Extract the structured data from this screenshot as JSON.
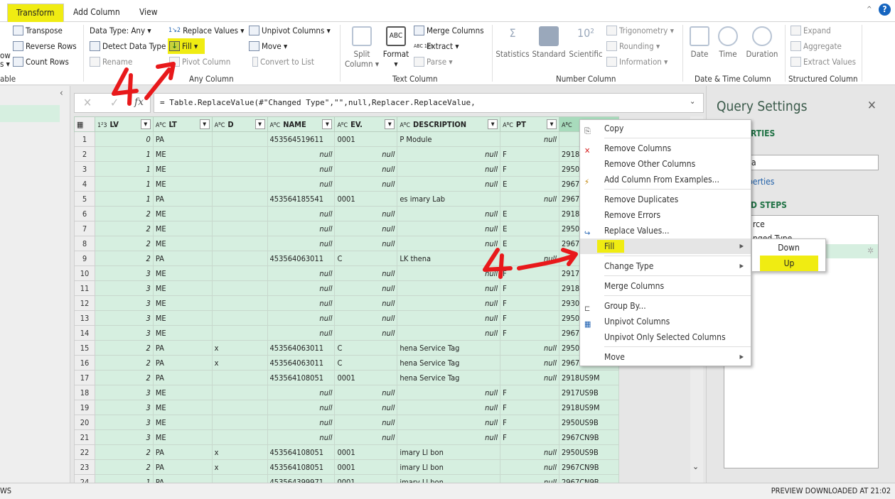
{
  "tabs": [
    "Transform",
    "Add Column",
    "View"
  ],
  "ribbon": {
    "table_group": {
      "label": "able",
      "partial": [
        "ow",
        "s ▾"
      ],
      "items": [
        "Transpose",
        "Reverse Rows",
        "Count Rows"
      ]
    },
    "any_column": {
      "label": "Any Column",
      "data_type": "Data Type: Any ▾",
      "detect": "Detect Data Type",
      "rename": "Rename",
      "replace": "Replace Values ▾",
      "fill": "Fill ▾",
      "pivot": "Pivot Column",
      "unpivot": "Unpivot Columns ▾",
      "move": "Move ▾",
      "convert": "Convert to List"
    },
    "text_column": {
      "label": "Text Column",
      "split": "Split Column ▾",
      "format": "Format ▾",
      "merge": "Merge Columns",
      "extract": "Extract ▾",
      "parse": "Parse ▾"
    },
    "number_column": {
      "label": "Number Column",
      "statistics": "Statistics",
      "standard": "Standard",
      "scientific": "Scientific",
      "trig": "Trigonometry ▾",
      "rounding": "Rounding ▾",
      "information": "Information ▾"
    },
    "datetime": {
      "label": "Date & Time Column",
      "date": "Date",
      "time": "Time",
      "duration": "Duration"
    },
    "structured": {
      "label": "Structured Column",
      "expand": "Expand",
      "aggregate": "Aggregate",
      "extract_values": "Extract Values"
    }
  },
  "formula": "= Table.ReplaceValue(#\"Changed Type\",\"\",null,Replacer.ReplaceValue,",
  "columns": [
    {
      "type": "1²3",
      "name": "LV"
    },
    {
      "type": "AᴮC",
      "name": "LT"
    },
    {
      "type": "AᴮC",
      "name": "D"
    },
    {
      "type": "AᴮC",
      "name": "NAME"
    },
    {
      "type": "AᴮC",
      "name": "EV."
    },
    {
      "type": "AᴮC",
      "name": "DESCRIPTION"
    },
    {
      "type": "AᴮC",
      "name": "PT"
    },
    {
      "type": "AᴮC",
      "name": ""
    }
  ],
  "rows": [
    [
      "1",
      "0",
      "PA",
      "",
      "453564519611",
      "0001",
      "P Module",
      "null",
      ""
    ],
    [
      "2",
      "1",
      "ME",
      "",
      "null",
      "null",
      "null",
      "F",
      "2918"
    ],
    [
      "3",
      "1",
      "ME",
      "",
      "null",
      "null",
      "null",
      "F",
      "2950"
    ],
    [
      "4",
      "1",
      "ME",
      "",
      "null",
      "null",
      "null",
      "E",
      "2967"
    ],
    [
      "5",
      "1",
      "PA",
      "",
      "453564185541",
      "0001",
      "es imary Lab",
      "null",
      "2967"
    ],
    [
      "6",
      "2",
      "ME",
      "",
      "null",
      "null",
      "null",
      "E",
      "2918"
    ],
    [
      "7",
      "2",
      "ME",
      "",
      "null",
      "null",
      "null",
      "E",
      "2950"
    ],
    [
      "8",
      "2",
      "ME",
      "",
      "null",
      "null",
      "null",
      "E",
      "2967"
    ],
    [
      "9",
      "2",
      "PA",
      "",
      "453564063011",
      "C",
      "LK thena",
      "null",
      ""
    ],
    [
      "10",
      "3",
      "ME",
      "",
      "null",
      "null",
      "null",
      "F",
      "2917"
    ],
    [
      "11",
      "3",
      "ME",
      "",
      "null",
      "null",
      "null",
      "F",
      "2918"
    ],
    [
      "12",
      "3",
      "ME",
      "",
      "null",
      "null",
      "null",
      "F",
      "2930"
    ],
    [
      "13",
      "3",
      "ME",
      "",
      "null",
      "null",
      "null",
      "F",
      "2950"
    ],
    [
      "14",
      "3",
      "ME",
      "",
      "null",
      "null",
      "null",
      "F",
      "2967"
    ],
    [
      "15",
      "2",
      "PA",
      "x",
      "453564063011",
      "C",
      "hena Service Tag",
      "null",
      "2950"
    ],
    [
      "16",
      "2",
      "PA",
      "x",
      "453564063011",
      "C",
      "hena Service Tag",
      "null",
      "2967"
    ],
    [
      "17",
      "2",
      "PA",
      "",
      "453564108051",
      "0001",
      "hena Service Tag",
      "null",
      "2918US9M"
    ],
    [
      "18",
      "3",
      "ME",
      "",
      "null",
      "null",
      "null",
      "F",
      "2917US9B"
    ],
    [
      "19",
      "3",
      "ME",
      "",
      "null",
      "null",
      "null",
      "F",
      "2918US9M"
    ],
    [
      "20",
      "3",
      "ME",
      "",
      "null",
      "null",
      "null",
      "F",
      "2950US9B"
    ],
    [
      "21",
      "3",
      "ME",
      "",
      "null",
      "null",
      "null",
      "F",
      "2967CN9B"
    ],
    [
      "22",
      "2",
      "PA",
      "x",
      "453564108051",
      "0001",
      "imary Ll bon",
      "null",
      "2950US9B"
    ],
    [
      "23",
      "2",
      "PA",
      "x",
      "453564108051",
      "0001",
      "imary Ll bon",
      "null",
      "2967CN9B"
    ],
    [
      "24",
      "1",
      "PA",
      "",
      "453564399971",
      "0001",
      "imary Ll bon",
      "null",
      "2967CN9B"
    ]
  ],
  "query_settings": {
    "title": "Query Settings",
    "properties_heading": "RTIES",
    "name_value": "a",
    "all_properties": "perties",
    "steps_heading": "D STEPS",
    "steps": [
      "rce",
      "nged Type",
      ""
    ]
  },
  "context_menu": {
    "items": [
      "Copy",
      "Remove Columns",
      "Remove Other Columns",
      "Add Column From Examples...",
      "Remove Duplicates",
      "Remove Errors",
      "Replace Values...",
      "Fill",
      "Change Type",
      "Merge Columns",
      "Group By...",
      "Unpivot Columns",
      "Unpivot Only Selected Columns",
      "Move"
    ]
  },
  "fill_submenu": [
    "Down",
    "Up"
  ],
  "status": {
    "left": "WS",
    "right": "PREVIEW DOWNLOADED AT 21:02"
  },
  "annotations": {
    "color": "#e8191b",
    "highlight": "#f0ec12",
    "mark": "4"
  }
}
